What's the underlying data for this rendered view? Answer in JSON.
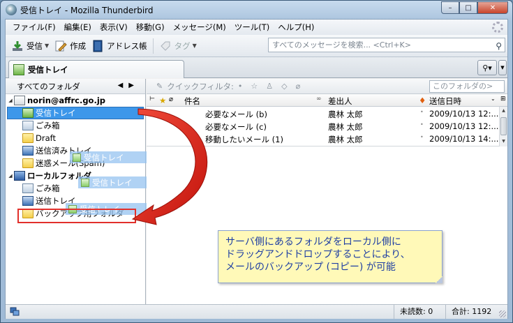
{
  "window": {
    "title": "受信トレイ - Mozilla Thunderbird",
    "minimize": "–",
    "maximize": "□",
    "close": "✕"
  },
  "menu": [
    "ファイル(F)",
    "編集(E)",
    "表示(V)",
    "移動(G)",
    "メッセージ(M)",
    "ツール(T)",
    "ヘルプ(H)"
  ],
  "toolbar": {
    "get_label": "受信",
    "write_label": "作成",
    "address_label": "アドレス帳",
    "tag_label": "タグ",
    "search_placeholder": "すべてのメッセージを検索... <Ctrl+K>"
  },
  "tab": {
    "label": "受信トレイ"
  },
  "folder_pane": {
    "header": "すべてのフォルダ",
    "accounts": [
      {
        "name": "norin@affrc.go.jp",
        "folders": [
          "受信トレイ",
          "ごみ箱",
          "Draft",
          "送信済みトレイ",
          "迷惑メール(Spam)"
        ]
      },
      {
        "name": "ローカルフォルダ",
        "folders": [
          "ごみ箱",
          "送信トレイ",
          "バックアップ用フォルダ"
        ]
      }
    ],
    "drag_label": "受信トレイ"
  },
  "quickfilter": {
    "label": "クイックフィルタ:",
    "search_placeholder": "このフォルダの>"
  },
  "columns": {
    "subject": "件名",
    "sender": "差出人",
    "date": "送信日時"
  },
  "messages": [
    {
      "subject": "必要なメール (b)",
      "sender": "農林 太郎",
      "date": "2009/10/13 12:..."
    },
    {
      "subject": "必要なメール (c)",
      "sender": "農林 太郎",
      "date": "2009/10/13 12:..."
    },
    {
      "subject": "移動したいメール (1)",
      "sender": "農林 太郎",
      "date": "2009/10/13 14:..."
    }
  ],
  "callout": {
    "line1": "サーバ側にあるフォルダをローカル側に",
    "line2": "ドラッグアンドドロップすることにより、",
    "line3": "メールのバックアップ (コピー) が可能"
  },
  "status": {
    "unread": "未読数: 0",
    "total": "合計: 1192"
  },
  "colors": {
    "selection": "#3d97ea",
    "arrow": "#d9251c",
    "callout_bg": "#fff9b8",
    "callout_text": "#1f3fa3"
  }
}
